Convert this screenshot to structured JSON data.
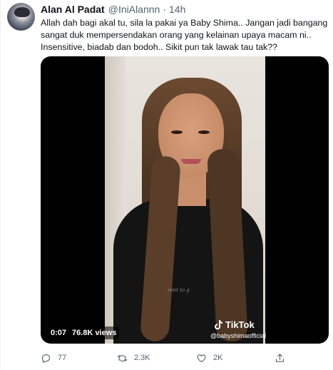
{
  "tweet": {
    "display_name": "Alan Al Padat",
    "handle": "@IniAlannn",
    "separator": "·",
    "time": "14h",
    "text_lines": [
      "Allah dah bagi akal tu, sila la pakai ya Baby Shima.. Jangan jadi bangang",
      "sangat duk mempersendakan orang yang kelainan upaya macam ni..",
      "Insensitive, biadab dan bodoh.. Sikit pun tak lawak tau tak??"
    ]
  },
  "video": {
    "time": "0:07",
    "views": "76.8K views",
    "watermark_brand": "TikTok",
    "watermark_user": "@babyshimaofficial",
    "shirt_print": "ront to g"
  },
  "actions": {
    "reply_count": "77",
    "retweet_count": "2.3K",
    "like_count": "2K"
  },
  "icons": {
    "reply": "reply-icon",
    "retweet": "retweet-icon",
    "like": "heart-icon",
    "share": "share-icon",
    "tiktok": "tiktok-icon"
  },
  "colors": {
    "text": "#0f1419",
    "secondary": "#536471",
    "media_bg": "#000000"
  }
}
